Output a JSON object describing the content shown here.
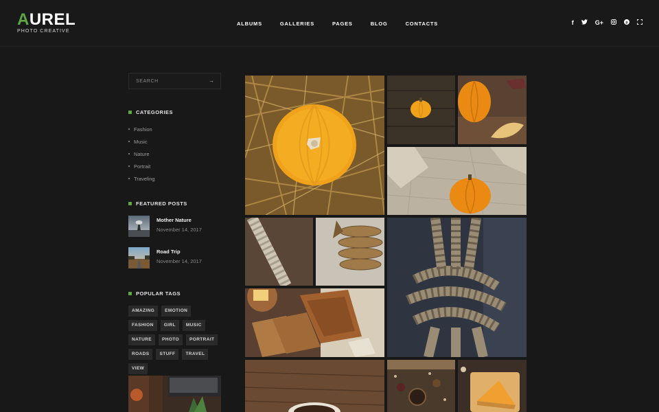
{
  "header": {
    "logo": {
      "first_letter": "A",
      "rest": "UREL",
      "tagline": "PHOTO CREATIVE"
    },
    "nav": [
      "ALBUMS",
      "GALLERIES",
      "PAGES",
      "BLOG",
      "CONTACTS"
    ],
    "social": [
      {
        "name": "facebook-icon",
        "glyph": "f"
      },
      {
        "name": "twitter-icon",
        "glyph": "t"
      },
      {
        "name": "google-plus-icon",
        "glyph": "G+"
      },
      {
        "name": "instagram-icon",
        "glyph": "◎"
      },
      {
        "name": "pinterest-icon",
        "glyph": "p"
      },
      {
        "name": "fullscreen-icon",
        "glyph": "⛶"
      }
    ]
  },
  "sidebar": {
    "search": {
      "placeholder": "SEARCH",
      "arrow": "→"
    },
    "categories": {
      "title": "CATEGORIES",
      "items": [
        "Fashion",
        "Music",
        "Nature",
        "Portrait",
        "Traveling"
      ]
    },
    "featured": {
      "title": "FEATURED POSTS",
      "posts": [
        {
          "title": "Mother Nature",
          "date": "November 14, 2017"
        },
        {
          "title": "Road Trip",
          "date": "November 14, 2017"
        }
      ]
    },
    "tags": {
      "title": "POPULAR TAGS",
      "items": [
        "AMAZING",
        "EMOTION",
        "FASHION",
        "GIRL",
        "MUSIC",
        "NATURE",
        "PHOTO",
        "PORTRAIT",
        "ROADS",
        "STUFF",
        "TRAVEL",
        "VIEW"
      ]
    }
  },
  "colors": {
    "background": "#181818",
    "accent": "#5fa745",
    "tag_bg": "#2a2a2a",
    "text_muted": "#9c9c9c"
  }
}
